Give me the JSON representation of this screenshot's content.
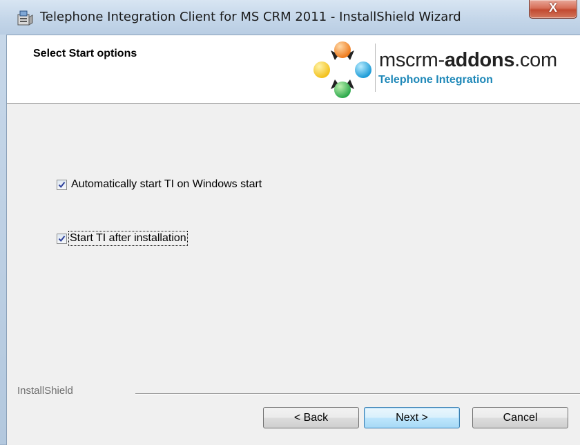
{
  "window": {
    "title": "Telephone Integration Client for MS CRM 2011 - InstallShield Wizard",
    "close_label": "X"
  },
  "header": {
    "title": "Select Start options",
    "logo_text_plain": "mscrm-",
    "logo_text_bold": "addons",
    "logo_text_suffix": ".com",
    "logo_subtitle": "Telephone Integration"
  },
  "options": [
    {
      "label": "Automatically start TI on Windows start",
      "checked": true
    },
    {
      "label": "Start TI after installation",
      "checked": true,
      "focused": true
    }
  ],
  "footer": {
    "brand": "InstallShield",
    "back_label": "< Back",
    "next_label": "Next >",
    "cancel_label": "Cancel"
  },
  "colors": {
    "accent": "#1e88b8",
    "close_red": "#c24a31",
    "default_button": "#3c7fb1"
  }
}
